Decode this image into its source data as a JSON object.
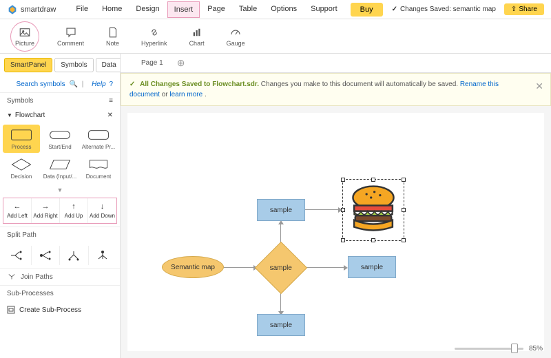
{
  "app": {
    "name": "smartdraw"
  },
  "menu": [
    "File",
    "Home",
    "Design",
    "Insert",
    "Page",
    "Table",
    "Options",
    "Support"
  ],
  "menu_highlight_index": 3,
  "buy_label": "Buy",
  "status": {
    "icon": "✓",
    "text": "Changes Saved: semantic map"
  },
  "share_label": "Share",
  "ribbon": [
    {
      "label": "Picture",
      "icon": "picture"
    },
    {
      "label": "Comment",
      "icon": "comment"
    },
    {
      "label": "Note",
      "icon": "note"
    },
    {
      "label": "Hyperlink",
      "icon": "hyperlink"
    },
    {
      "label": "Chart",
      "icon": "chart"
    },
    {
      "label": "Gauge",
      "icon": "gauge"
    }
  ],
  "ribbon_highlight_index": 0,
  "panel": {
    "tabs": [
      "SmartPanel",
      "Symbols",
      "Data"
    ],
    "active_tab": 0,
    "search_label": "Search symbols",
    "help_label": "Help",
    "symbols_header": "Symbols",
    "category": "Flowchart",
    "shapes": [
      "Process",
      "Start/End",
      "Alternate Pr...",
      "Decision",
      "Data (Input/...",
      "Document"
    ],
    "active_shape": 0,
    "add": [
      "Add Left",
      "Add Right",
      "Add Up",
      "Add Down"
    ],
    "split_header": "Split Path",
    "join_header": "Join Paths",
    "sub_header": "Sub-Processes",
    "create_sub": "Create Sub-Process"
  },
  "doc": {
    "tab": "Page 1"
  },
  "notice": {
    "title": "All Changes Saved to Flowchart.sdr.",
    "body1": " Changes you make to this document will automatically be saved. ",
    "link1": "Rename this document",
    "body2": " or ",
    "link2": "learn more",
    "body3": "."
  },
  "nodes": {
    "start": "Semantic map",
    "top": "sample",
    "center": "sample",
    "right": "sample",
    "bottom": "sample"
  },
  "zoom": "85%"
}
